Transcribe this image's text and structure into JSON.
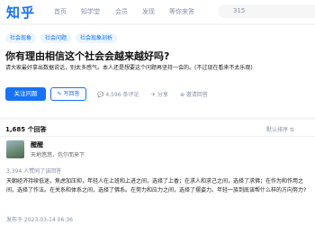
{
  "header": {
    "logo": "知乎",
    "nav": [
      "首页",
      "知学堂",
      "会员",
      "发现",
      "等你来答"
    ],
    "search_text": "315"
  },
  "question": {
    "tags": [
      "社会现象",
      "社会问题",
      "社会现象剖析"
    ],
    "title": "你有理由相信这个社会会越来越好吗?",
    "description": "请大家最好拿出数据说话，别太多感气。本人还是想要这个问题再坚持一会的。(不过现在看来不太乐观)",
    "follow_label": "关注问题",
    "write_label": "✎ 写回答",
    "comment_label": "💬 4,596 条评论",
    "share_label": "✈ 分享",
    "invite_label": "⊕ 邀请回答"
  },
  "answers": {
    "count_label": "1,685 个回答",
    "sort_label": "默认排序 ⇅",
    "first": {
      "author": "醒醒",
      "bio": "天地悠悠，包尔而来下",
      "upvotes": "3,394 人赞同了该回答",
      "body": "天朝经济持续低迷，焦虑加压抑，年轻人在上班和上进之间，选择了上香；在求人和求己之间，选择了求佛；在作为和作用之间，选择了作法。在关系和体系之间，选择了佛系。在努力和应力之间，选择了摆姿力。年轻一族到底该帮什么样的方向努力?",
      "date": "发布于 2023-03-14 06:36"
    }
  }
}
